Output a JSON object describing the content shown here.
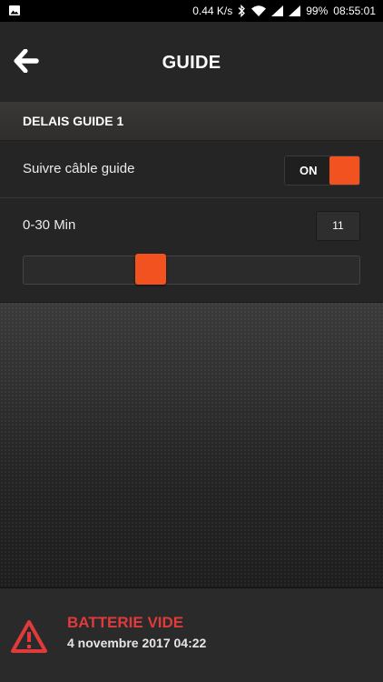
{
  "status_bar": {
    "speed": "0.44 K/s",
    "battery": "99%",
    "time": "08:55:01"
  },
  "app_bar": {
    "title": "GUIDE",
    "back_icon": "arrow-left-icon"
  },
  "section": {
    "title": "DELAIS GUIDE 1"
  },
  "guide_cable": {
    "label": "Suivre câble guide",
    "toggle_label": "ON",
    "enabled": true
  },
  "delay": {
    "label": "0-30 Min",
    "value": "11",
    "min": 0,
    "max": 30,
    "current": 11
  },
  "alert": {
    "title": "BATTERIE VIDE",
    "date": "4 novembre 2017 04:22",
    "icon": "warning-triangle-icon"
  },
  "colors": {
    "accent": "#f2521f",
    "alert": "#e03a3a",
    "background": "#252525"
  }
}
